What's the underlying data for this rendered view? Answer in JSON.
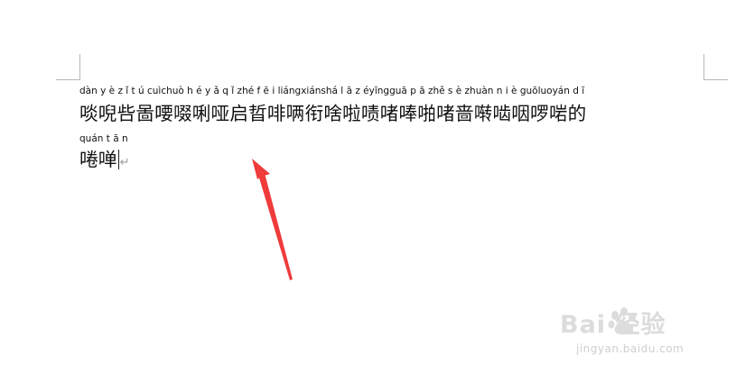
{
  "document": {
    "line1": {
      "pinyin": "dàn y è z ǐ t ú cuìchuò h é y ǎ q ǐ zhé f ē i liángxiánshá l ā z éyīngguā p ā zhě s è zhuàn n i è guōluoyán d ī",
      "text": "啖唲呰啚喓啜唎哑启晢啡唡衔啥啦啧啫唪啪啫啬啭啮咽啰啱的"
    },
    "line2": {
      "pinyin": "quán t ā n",
      "text": "啳啴"
    },
    "paragraph_mark": "↵"
  },
  "annotation": {
    "arrow_color": "#ef3b3b"
  },
  "watermark": {
    "logo": "Bai  经验",
    "url": "jingyan.baidu.com",
    "paw_icon": "baidu-paw-icon"
  }
}
